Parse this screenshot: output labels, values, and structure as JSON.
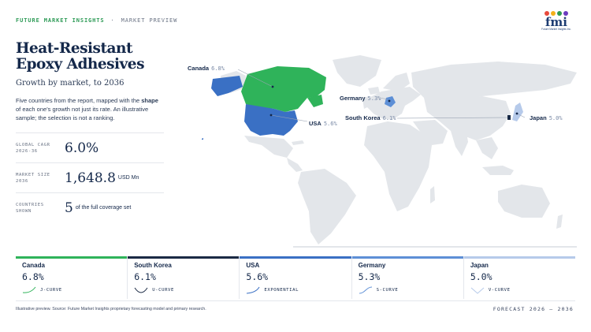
{
  "header": {
    "brand": "FUTURE MARKET INSIGHTS",
    "separator": "·",
    "section": "MARKET PREVIEW"
  },
  "logo": {
    "text": "fmi",
    "subtitle": "Future Market Insights Inc.",
    "dot_colors": [
      "#e84a3c",
      "#f4b019",
      "#2f9a52",
      "#6a3bbf"
    ]
  },
  "title": "Heat-Resistant Epoxy Adhesives",
  "subtitle": "Growth by market, to 2036",
  "description": {
    "before": "Five countries from the report, mapped with the ",
    "bold": "shape",
    "after": " of each one's growth not just its rate. An illustrative sample; the selection is not a ranking."
  },
  "stats": [
    {
      "label": "GLOBAL CAGR\n2026-36",
      "value": "6.0%",
      "unit": ""
    },
    {
      "label": "MARKET SIZE\n2036",
      "value": "1,648.8",
      "unit": "USD Mn"
    },
    {
      "label": "COUNTRIES\nSHOWN",
      "value": "5",
      "unit": "of the full coverage set"
    }
  ],
  "map_labels": [
    {
      "country": "Canada",
      "value": "6.8%"
    },
    {
      "country": "Germany",
      "value": "5.3%"
    },
    {
      "country": "USA",
      "value": "5.6%"
    },
    {
      "country": "South Korea",
      "value": "6.1%"
    },
    {
      "country": "Japan",
      "value": "5.0%"
    }
  ],
  "colors": {
    "canada": "#2fb35a",
    "usa": "#3a70c4",
    "germany": "#5d8fd6",
    "south_korea": "#1b2a44",
    "japan": "#b6caea",
    "land": "#e3e6ea"
  },
  "cards": [
    {
      "country": "Canada",
      "value": "6.8%",
      "curve": "J-CURVE",
      "color": "#2fb35a"
    },
    {
      "country": "South Korea",
      "value": "6.1%",
      "curve": "U-CURVE",
      "color": "#1b2a44"
    },
    {
      "country": "USA",
      "value": "5.6%",
      "curve": "EXPONENTIAL",
      "color": "#3a70c4"
    },
    {
      "country": "Germany",
      "value": "5.3%",
      "curve": "S-CURVE",
      "color": "#5d8fd6"
    },
    {
      "country": "Japan",
      "value": "5.0%",
      "curve": "V-CURVE",
      "color": "#b6caea"
    }
  ],
  "footer": {
    "note": "Illustrative preview. Source: Future Market Insights proprietary forecasting model and primary research.",
    "right": "FORECAST 2026 – 2036"
  }
}
